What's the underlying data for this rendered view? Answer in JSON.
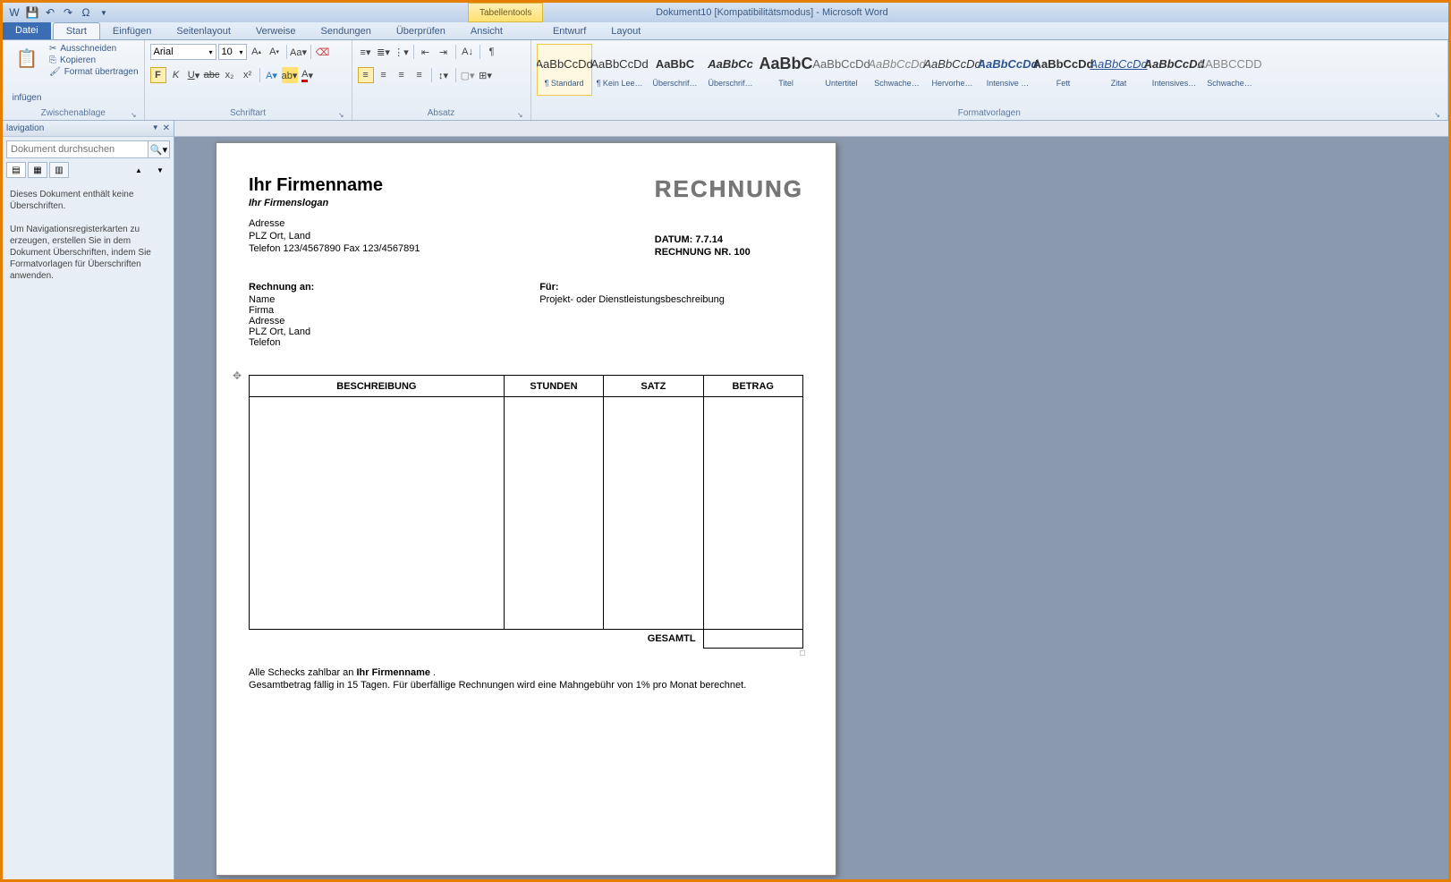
{
  "title": "Dokument10 [Kompatibilitätsmodus] - Microsoft Word",
  "tabletools_label": "Tabellentools",
  "tabs": {
    "file": "Datei",
    "items": [
      "Start",
      "Einfügen",
      "Seitenlayout",
      "Verweise",
      "Sendungen",
      "Überprüfen",
      "Ansicht"
    ],
    "table": [
      "Entwurf",
      "Layout"
    ],
    "active": "Start"
  },
  "clipboard": {
    "paste": "infügen",
    "cut": "Ausschneiden",
    "copy": "Kopieren",
    "format": "Format übertragen",
    "group": "Zwischenablage"
  },
  "font": {
    "name": "Arial",
    "size": "10",
    "group": "Schriftart"
  },
  "paragraph": {
    "group": "Absatz"
  },
  "styles": {
    "group": "Formatvorlagen",
    "items": [
      {
        "preview": "AaBbCcDd",
        "name": "¶ Standard",
        "style": "normal",
        "sel": true
      },
      {
        "preview": "AaBbCcDd",
        "name": "¶ Kein Lee…",
        "style": "normal"
      },
      {
        "preview": "AaBbC",
        "name": "Überschrif…",
        "style": "bold color:#2f5496;font-size:16px"
      },
      {
        "preview": "AaBbCc",
        "name": "Überschrif…",
        "style": "bold italic color:#2f5496;font-size:14px"
      },
      {
        "preview": "AaBbC",
        "name": "Titel",
        "style": "bold font-size:18px"
      },
      {
        "preview": "AaBbCcDd",
        "name": "Untertitel",
        "style": "color:#666"
      },
      {
        "preview": "AaBbCcDd",
        "name": "Schwache…",
        "style": "italic color:#888"
      },
      {
        "preview": "AaBbCcDd",
        "name": "Hervorhe…",
        "style": "italic"
      },
      {
        "preview": "AaBbCcDd",
        "name": "Intensive …",
        "style": "italic bold color:#2f5496"
      },
      {
        "preview": "AaBbCcDd",
        "name": "Fett",
        "style": "bold"
      },
      {
        "preview": "AaBbCcDd",
        "name": "Zitat",
        "style": "italic underline color:#2f5496"
      },
      {
        "preview": "AaBbCcDd",
        "name": "Intensives…",
        "style": "italic bold"
      },
      {
        "preview": "AABBCCDD",
        "name": "Schwache…",
        "style": "small-caps color:#888"
      }
    ]
  },
  "nav": {
    "title": "lavigation",
    "search_ph": "Dokument durchsuchen",
    "msg1": "Dieses Dokument enthält keine Überschriften.",
    "msg2": "Um Navigationsregisterkarten zu erzeugen, erstellen Sie in dem Dokument Überschriften, indem Sie Formatvorlagen für Überschriften anwenden."
  },
  "doc": {
    "company": "Ihr Firmenname",
    "slogan": "Ihr Firmenslogan",
    "invoice_title": "RECHNUNG",
    "addr_l1": "Adresse",
    "addr_l2": "PLZ Ort, Land",
    "addr_l3": "Telefon 123/4567890    Fax 123/4567891",
    "date_lbl": "DATUM:  7.7.14",
    "inv_lbl": "RECHNUNG  NR. 100",
    "bill_to_h": "Rechnung an:",
    "bill_to_l1": "Name",
    "bill_to_l2": "Firma",
    "bill_to_l3": "Adresse",
    "bill_to_l4": "PLZ Ort, Land",
    "bill_to_l5": "Telefon",
    "for_h": "Für:",
    "for_l1": "Projekt- oder Dienstleistungsbeschreibung",
    "th1": "BESCHREIBUNG",
    "th2": "STUNDEN",
    "th3": "SATZ",
    "th4": "BETRAG",
    "total": "GESAMTL",
    "foot1_a": "Alle Schecks zahlbar an ",
    "foot1_b": "Ihr Firmenname",
    "foot1_c": " .",
    "foot2": "Gesamtbetrag fällig in 15 Tagen. Für überfällige Rechnungen wird eine Mahngebühr von 1% pro Monat berechnet."
  }
}
